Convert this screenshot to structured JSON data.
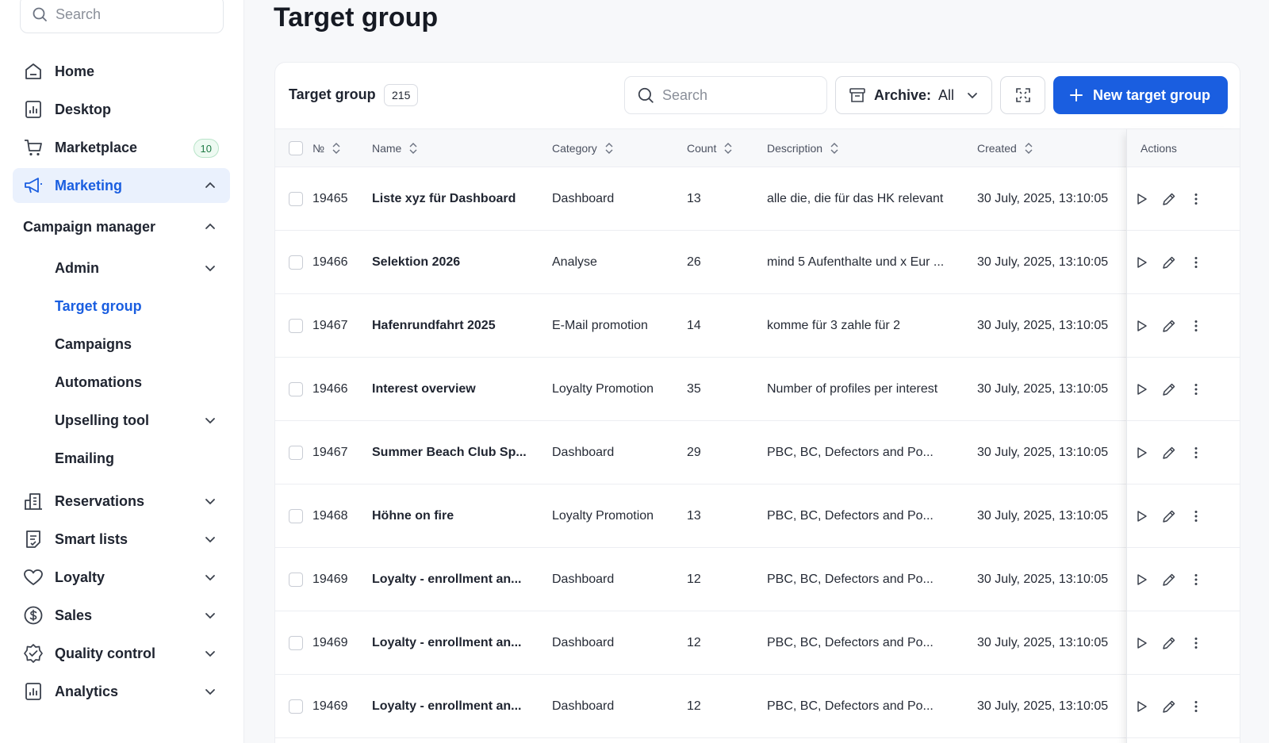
{
  "sidebar": {
    "search_placeholder": "Search",
    "nav": [
      {
        "label": "Home",
        "icon": "home-icon"
      },
      {
        "label": "Desktop",
        "icon": "bar-chart-icon"
      },
      {
        "label": "Marketplace",
        "icon": "cart-icon",
        "badge": "10"
      },
      {
        "label": "Marketing",
        "icon": "megaphone-icon"
      }
    ],
    "group_title": "Campaign manager",
    "sub_items": [
      "Admin",
      "Target group",
      "Campaigns",
      "Automations",
      "Upselling tool",
      "Emailing"
    ],
    "bottom_nav": [
      {
        "label": "Reservations",
        "icon": "building-icon"
      },
      {
        "label": "Smart lists",
        "icon": "list-icon"
      },
      {
        "label": "Loyalty",
        "icon": "heart-icon"
      },
      {
        "label": "Sales",
        "icon": "dollar-icon"
      },
      {
        "label": "Quality control",
        "icon": "badge-check-icon"
      },
      {
        "label": "Analytics",
        "icon": "analytics-icon"
      }
    ]
  },
  "page": {
    "title": "Target group"
  },
  "card": {
    "title": "Target group",
    "count": "215",
    "search_placeholder": "Search",
    "archive_label": "Archive:",
    "archive_value": "All",
    "new_button": "New target group"
  },
  "table": {
    "columns": [
      "№",
      "Name",
      "Category",
      "Count",
      "Description",
      "Created",
      "Actions"
    ],
    "rows": [
      {
        "id": "19465",
        "name": "Liste xyz für Dashboard",
        "category": "Dashboard",
        "count": "13",
        "description": "alle die, die für das HK relevant",
        "created": "30 July, 2025, 13:10:05"
      },
      {
        "id": "19466",
        "name": "Selektion 2026",
        "category": "Analyse",
        "count": "26",
        "description": "mind 5 Aufenthalte und x Eur ...",
        "created": "30 July, 2025, 13:10:05"
      },
      {
        "id": "19467",
        "name": "Hafenrundfahrt 2025",
        "category": "E-Mail promotion",
        "count": "14",
        "description": "komme für 3 zahle für 2",
        "created": "30 July, 2025, 13:10:05"
      },
      {
        "id": "19466",
        "name": "Interest overview",
        "category": "Loyalty Promotion",
        "count": "35",
        "description": "Number of profiles per interest",
        "created": "30 July, 2025, 13:10:05"
      },
      {
        "id": "19467",
        "name": "Summer Beach Club Sp...",
        "category": "Dashboard",
        "count": "29",
        "description": "PBC, BC, Defectors and Po...",
        "created": "30 July, 2025, 13:10:05"
      },
      {
        "id": "19468",
        "name": "Höhne on fire",
        "category": "Loyalty Promotion",
        "count": "13",
        "description": "PBC, BC, Defectors and Po...",
        "created": "30 July, 2025, 13:10:05"
      },
      {
        "id": "19469",
        "name": "Loyalty - enrollment an...",
        "category": "Dashboard",
        "count": "12",
        "description": "PBC, BC, Defectors and Po...",
        "created": "30 July, 2025, 13:10:05"
      },
      {
        "id": "19469",
        "name": "Loyalty - enrollment an...",
        "category": "Dashboard",
        "count": "12",
        "description": "PBC, BC, Defectors and Po...",
        "created": "30 July, 2025, 13:10:05"
      },
      {
        "id": "19469",
        "name": "Loyalty - enrollment an...",
        "category": "Dashboard",
        "count": "12",
        "description": "PBC, BC, Defectors and Po...",
        "created": "30 July, 2025, 13:10:05"
      }
    ]
  },
  "colors": {
    "accent": "#1a5ee0",
    "active_bg": "#eaf1fd",
    "badge_green": "#1f7a45"
  }
}
